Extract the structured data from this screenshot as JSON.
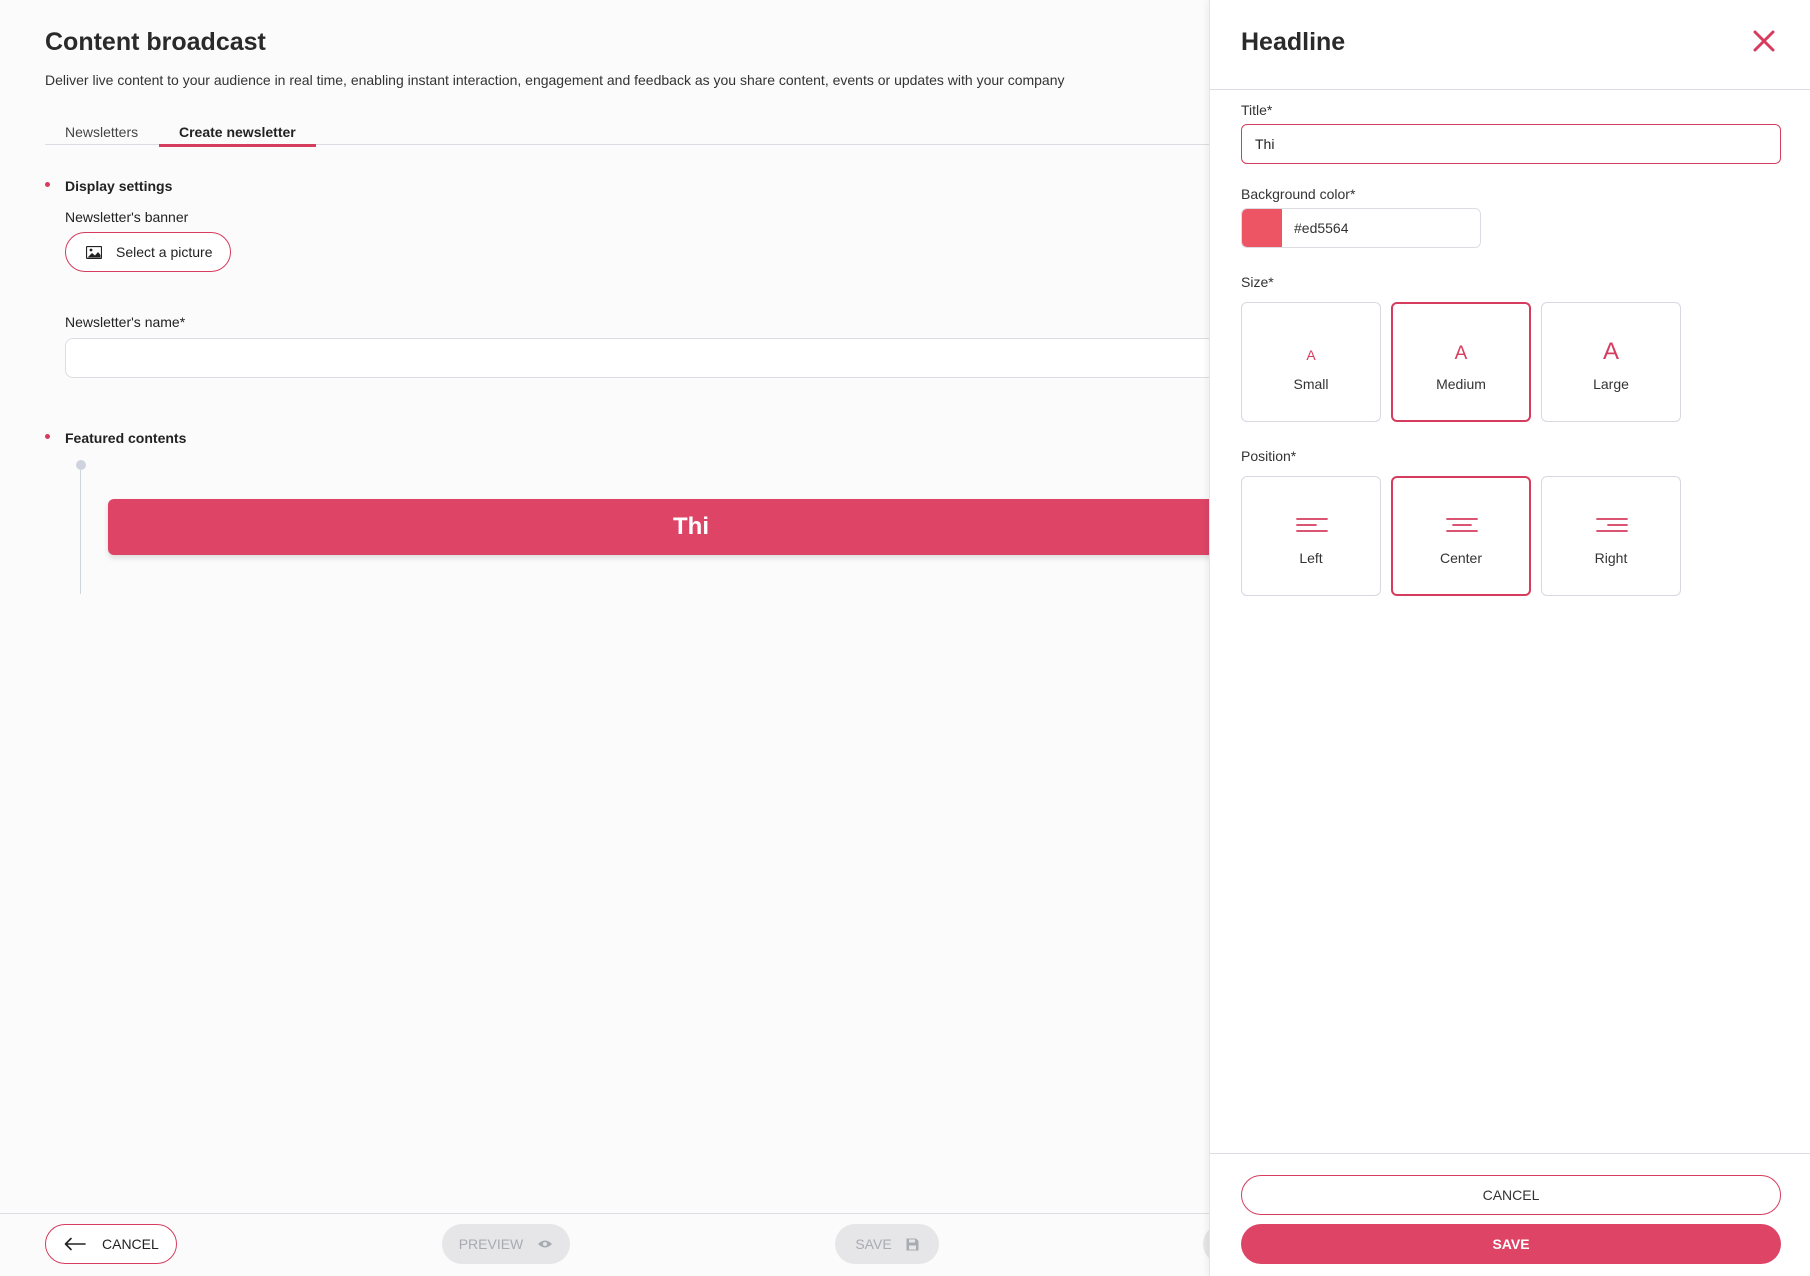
{
  "colors": {
    "accent": "#d63c5e",
    "headline_bg": "#ed5564"
  },
  "main": {
    "title": "Content broadcast",
    "description": "Deliver live content to your audience in real time, enabling instant interaction, engagement and feedback as you share content, events or updates with your company",
    "tabs": [
      {
        "label": "Newsletters",
        "active": false
      },
      {
        "label": "Create newsletter",
        "active": true
      }
    ],
    "display_settings": {
      "section_title": "Display settings",
      "banner_label": "Newsletter's banner",
      "select_picture_label": "Select a picture",
      "picture_icon": "image-icon",
      "name_label": "Newsletter's name*",
      "name_value": ""
    },
    "featured": {
      "section_title": "Featured contents",
      "headline_text": "Thi"
    },
    "footer": {
      "cancel_label": "CANCEL",
      "cancel_icon": "arrow-left-icon",
      "preview_label": "PREVIEW",
      "preview_icon": "eye-icon",
      "save_label": "SAVE",
      "save_icon": "floppy-disk-icon"
    }
  },
  "panel": {
    "title": "Headline",
    "close_icon": "close-icon",
    "title_label": "Title*",
    "title_value": "Thi",
    "bg_color_label": "Background color*",
    "bg_color_value": "#ed5564",
    "size_label": "Size*",
    "sizes": [
      {
        "glyph": "A",
        "label": "Small",
        "selected": false
      },
      {
        "glyph": "A",
        "label": "Medium",
        "selected": true
      },
      {
        "glyph": "A",
        "label": "Large",
        "selected": false
      }
    ],
    "position_label": "Position*",
    "positions": [
      {
        "label": "Left",
        "icon": "align-left-icon",
        "selected": false
      },
      {
        "label": "Center",
        "icon": "align-center-icon",
        "selected": true
      },
      {
        "label": "Right",
        "icon": "align-right-icon",
        "selected": false
      }
    ],
    "cancel_label": "CANCEL",
    "save_label": "SAVE"
  }
}
